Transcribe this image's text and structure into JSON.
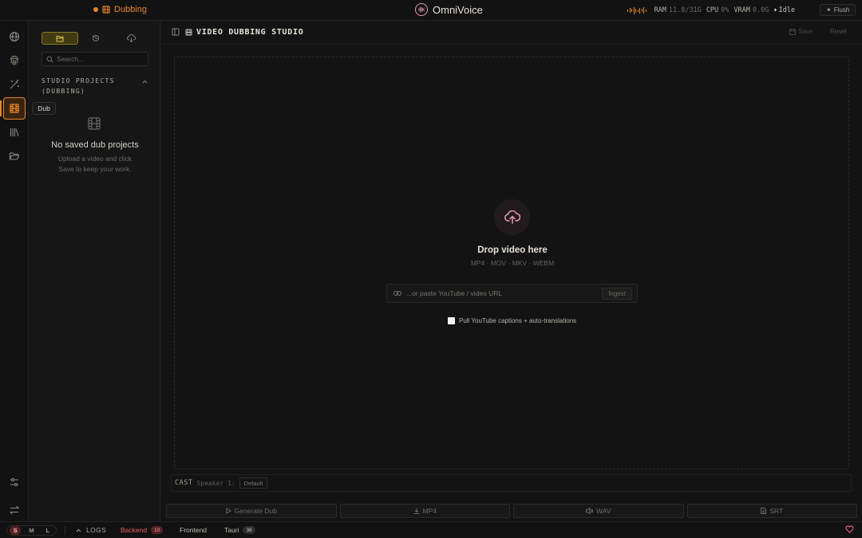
{
  "topbar": {
    "crumb": "Dubbing",
    "app_name": "OmniVoice",
    "stats": {
      "ram_label": "RAM",
      "ram_value": "11.8/31G",
      "cpu_label": "CPU",
      "cpu_value": "0%",
      "vram_label": "VRAM",
      "vram_value": "0.0G",
      "status": "Idle"
    },
    "flush_label": "Flush"
  },
  "rail": {
    "items": [
      "globe-icon",
      "fingerprint-icon",
      "magic-wand-icon",
      "film-icon",
      "library-icon",
      "folder-open-icon"
    ],
    "active_item": "film-icon",
    "tooltip": "Dub",
    "bottom_items": [
      "sliders-icon",
      "swap-icon"
    ]
  },
  "projects": {
    "tabs": [
      "folder-icon",
      "history-icon",
      "cloud-download-icon"
    ],
    "active_tab": "folder-icon",
    "search_placeholder": "Search...",
    "section_title": "STUDIO PROJECTS (DUBBING)",
    "empty_title": "No saved dub projects",
    "empty_sub": "Upload a video and click Save to keep your work."
  },
  "main": {
    "title": "VIDEO DUBBING STUDIO",
    "save_label": "Save",
    "reset_label": "Reset",
    "drop_title": "Drop video here",
    "formats": "MP4 · MOV · MKV · WEBM",
    "url_placeholder": "...or paste YouTube / video URL",
    "ingest_label": "Ingest",
    "captions_label": "Pull YouTube captions + auto-translations",
    "captions_checked": false,
    "cast_label": "CAST",
    "speaker_label": "Speaker 1:",
    "speaker_value": "Default",
    "actions": [
      "Generate Dub",
      "MP4",
      "WAV",
      "SRT"
    ]
  },
  "statusbar": {
    "sizes": [
      "S",
      "M",
      "L"
    ],
    "active_size": "S",
    "logs_label": "LOGS",
    "backend_label": "Backend",
    "backend_count": "10",
    "frontend_label": "Frontend",
    "tauri_label": "Tauri",
    "tauri_count": "38"
  },
  "colors": {
    "accent": "#e8852a",
    "brand": "#e79ab3",
    "error": "#e65a78",
    "background": "#141414"
  }
}
